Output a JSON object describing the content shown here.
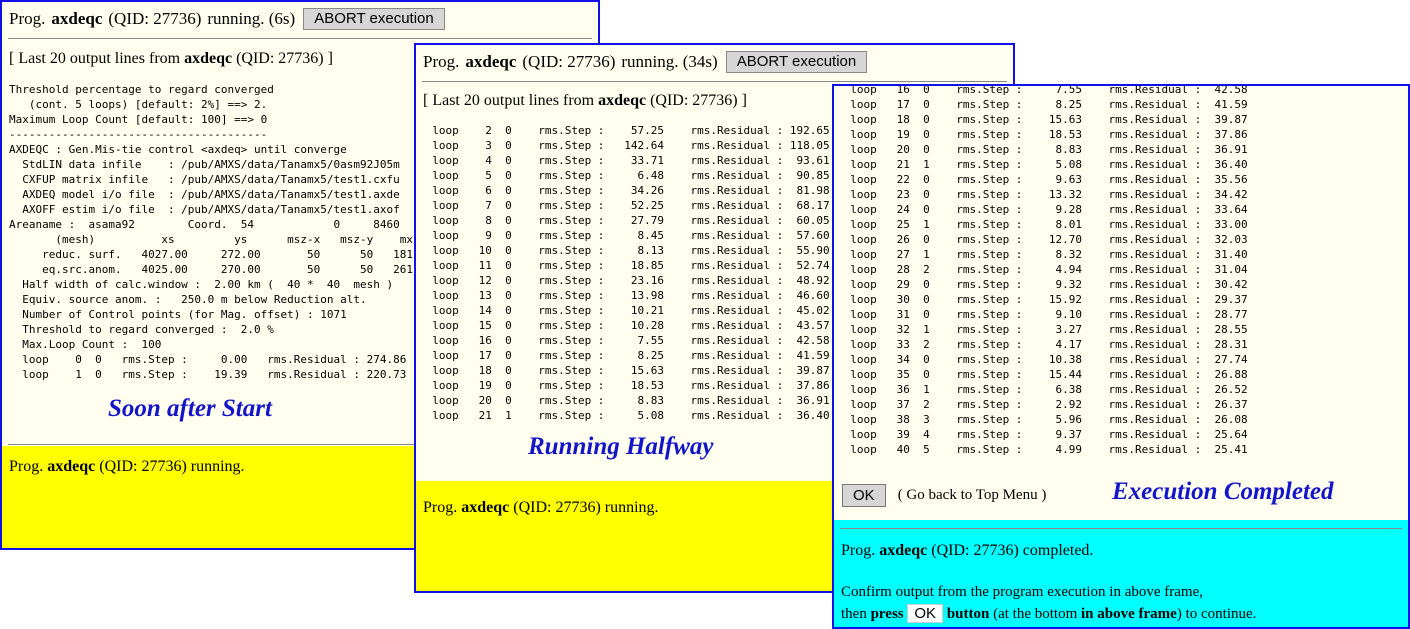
{
  "program": "axdeqc",
  "qid": "(QID: 27736)",
  "abort_label": "ABORT execution",
  "last20_pre": "[ Last 20 output lines from ",
  "last20_post": " (QID: 27736) ]",
  "prog_word": "Prog.",
  "w1": {
    "header_status": "running. (6s)",
    "caption": "Soon after Start",
    "status": "running.",
    "output": [
      "Threshold percentage to regard converged",
      "   (cont. 5 loops) [default: 2%] ==> 2.",
      "Maximum Loop Count [default: 100] ==> 0",
      "---------------------------------------",
      "AXDEQC : Gen.Mis-tie control <axdeq> until converge",
      "  StdLIN data infile    : /pub/AMXS/data/Tanamx5/0asm92J05m",
      "  CXFUP matrix infile   : /pub/AMXS/data/Tanamx5/test1.cxfu",
      "  AXDEQ model i/o file  : /pub/AMXS/data/Tanamx5/test1.axde",
      "  AXOFF estim i/o file  : /pub/AMXS/data/Tanamx5/test1.axof",
      "Areaname :  asama92        Coord.  54            0     8460",
      "       (mesh)          xs         ys      msz-x   msz-y    mx",
      "     reduc. surf.   4027.00     272.00       50      50   181",
      "     eq.src.anom.   4025.00     270.00       50      50   261",
      "  Half width of calc.window :  2.00 km (  40 *  40  mesh )",
      "  Equiv. source anom. :   250.0 m below Reduction alt.",
      "  Number of Control points (for Mag. offset) : 1071",
      "  Threshold to regard converged :  2.0 %",
      "  Max.Loop Count :  100",
      "  loop    0  0   rms.Step :     0.00   rms.Residual : 274.86",
      "  loop    1  0   rms.Step :    19.39   rms.Residual : 220.73"
    ]
  },
  "w2": {
    "header_status": "running. (34s)",
    "caption": "Running Halfway",
    "status": "running.",
    "output": [
      "  loop    2  0    rms.Step :    57.25    rms.Residual : 192.65",
      "  loop    3  0    rms.Step :   142.64    rms.Residual : 118.05",
      "  loop    4  0    rms.Step :    33.71    rms.Residual :  93.61",
      "  loop    5  0    rms.Step :     6.48    rms.Residual :  90.85",
      "  loop    6  0    rms.Step :    34.26    rms.Residual :  81.98",
      "  loop    7  0    rms.Step :    52.25    rms.Residual :  68.17",
      "  loop    8  0    rms.Step :    27.79    rms.Residual :  60.05",
      "  loop    9  0    rms.Step :     8.45    rms.Residual :  57.60",
      "  loop   10  0    rms.Step :     8.13    rms.Residual :  55.90",
      "  loop   11  0    rms.Step :    18.85    rms.Residual :  52.74",
      "  loop   12  0    rms.Step :    23.16    rms.Residual :  48.92",
      "  loop   13  0    rms.Step :    13.98    rms.Residual :  46.60",
      "  loop   14  0    rms.Step :    10.21    rms.Residual :  45.02",
      "  loop   15  0    rms.Step :    10.28    rms.Residual :  43.57",
      "  loop   16  0    rms.Step :     7.55    rms.Residual :  42.58",
      "  loop   17  0    rms.Step :     8.25    rms.Residual :  41.59",
      "  loop   18  0    rms.Step :    15.63    rms.Residual :  39.87",
      "  loop   19  0    rms.Step :    18.53    rms.Residual :  37.86",
      "  loop   20  0    rms.Step :     8.83    rms.Residual :  36.91",
      "  loop   21  1    rms.Step :     5.08    rms.Residual :  36.40"
    ]
  },
  "w3": {
    "caption": "Execution Completed",
    "ok_label": "OK",
    "back_label": "( Go back to Top Menu )",
    "status": "completed.",
    "confirm_line": "Confirm output from the program execution in above frame,",
    "then_word": "then",
    "press_word": "press",
    "button_word": "button",
    "at_bottom": "(at the bottom",
    "in_above_frame": "in above frame",
    "to_continue": ") to continue.",
    "output": [
      "  loop   16  0    rms.Step :     7.55    rms.Residual :  42.58",
      "  loop   17  0    rms.Step :     8.25    rms.Residual :  41.59",
      "  loop   18  0    rms.Step :    15.63    rms.Residual :  39.87",
      "  loop   19  0    rms.Step :    18.53    rms.Residual :  37.86",
      "  loop   20  0    rms.Step :     8.83    rms.Residual :  36.91",
      "  loop   21  1    rms.Step :     5.08    rms.Residual :  36.40",
      "  loop   22  0    rms.Step :     9.63    rms.Residual :  35.56",
      "  loop   23  0    rms.Step :    13.32    rms.Residual :  34.42",
      "  loop   24  0    rms.Step :     9.28    rms.Residual :  33.64",
      "  loop   25  1    rms.Step :     8.01    rms.Residual :  33.00",
      "  loop   26  0    rms.Step :    12.70    rms.Residual :  32.03",
      "  loop   27  1    rms.Step :     8.32    rms.Residual :  31.40",
      "  loop   28  2    rms.Step :     4.94    rms.Residual :  31.04",
      "  loop   29  0    rms.Step :     9.32    rms.Residual :  30.42",
      "  loop   30  0    rms.Step :    15.92    rms.Residual :  29.37",
      "  loop   31  0    rms.Step :     9.10    rms.Residual :  28.77",
      "  loop   32  1    rms.Step :     3.27    rms.Residual :  28.55",
      "  loop   33  2    rms.Step :     4.17    rms.Residual :  28.31",
      "  loop   34  0    rms.Step :    10.38    rms.Residual :  27.74",
      "  loop   35  0    rms.Step :    15.44    rms.Residual :  26.88",
      "  loop   36  1    rms.Step :     6.38    rms.Residual :  26.52",
      "  loop   37  2    rms.Step :     2.92    rms.Residual :  26.37",
      "  loop   38  3    rms.Step :     5.96    rms.Residual :  26.08",
      "  loop   39  4    rms.Step :     9.37    rms.Residual :  25.64",
      "  loop   40  5    rms.Step :     4.99    rms.Residual :  25.41"
    ]
  },
  "colors": {
    "frame_border": "#1010e8",
    "output_bg": "#fffff0",
    "running_status_bg": "#ffff00",
    "completed_status_bg": "#00ffff",
    "caption_text": "#1414c8"
  }
}
